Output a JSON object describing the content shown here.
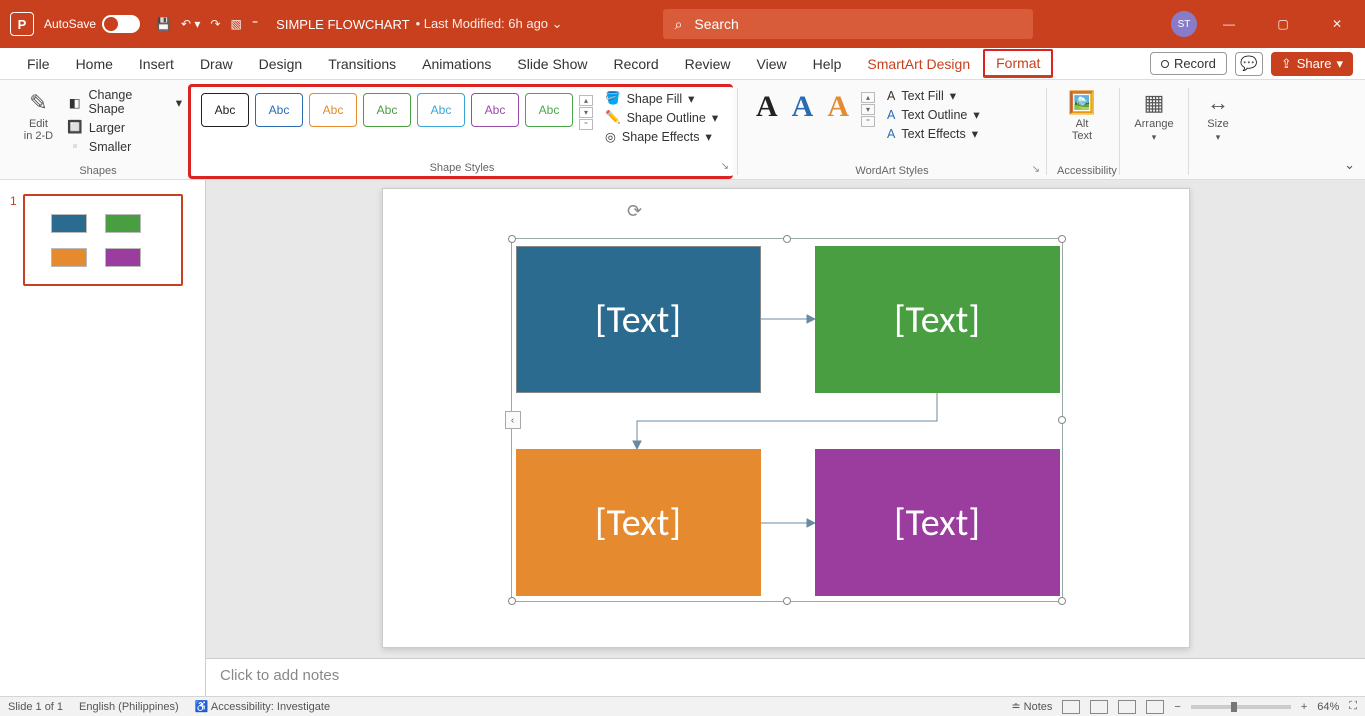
{
  "title": {
    "autosave": "AutoSave",
    "doc": "SIMPLE FLOWCHART",
    "modified": "• Last Modified: 6h ago",
    "search_placeholder": "Search",
    "avatar": "ST"
  },
  "tabs": [
    "File",
    "Home",
    "Insert",
    "Draw",
    "Design",
    "Transitions",
    "Animations",
    "Slide Show",
    "Record",
    "Review",
    "View",
    "Help"
  ],
  "context_tabs": [
    "SmartArt Design",
    "Format"
  ],
  "menu_right": {
    "record": "Record",
    "share": "Share"
  },
  "ribbon": {
    "shapes": {
      "edit2d": "Edit\nin 2-D",
      "change": "Change Shape",
      "larger": "Larger",
      "smaller": "Smaller",
      "label": "Shapes"
    },
    "shape_styles": {
      "swatches": [
        {
          "text": "Abc",
          "border": "#222",
          "fill": "#fff"
        },
        {
          "text": "Abc",
          "border": "#2a6cb1",
          "fill": "#fff"
        },
        {
          "text": "Abc",
          "border": "#e58a2e",
          "fill": "#fff"
        },
        {
          "text": "Abc",
          "border": "#4a9e42",
          "fill": "#fff"
        },
        {
          "text": "Abc",
          "border": "#3aa5d8",
          "fill": "#fff"
        },
        {
          "text": "Abc",
          "border": "#9a4aa8",
          "fill": "#fff"
        },
        {
          "text": "Abc",
          "border": "#4aa84a",
          "fill": "#fff"
        }
      ],
      "fill": "Shape Fill",
      "outline": "Shape Outline",
      "effects": "Shape Effects",
      "label": "Shape Styles"
    },
    "wordart": {
      "text_fill": "Text Fill",
      "text_outline": "Text Outline",
      "text_effects": "Text Effects",
      "label": "WordArt Styles"
    },
    "acc": {
      "alt": "Alt\nText",
      "label": "Accessibility"
    },
    "arrange": "Arrange",
    "size": "Size"
  },
  "slide_num": "1",
  "blocks": {
    "a": "[Text]",
    "b": "[Text]",
    "c": "[Text]",
    "d": "[Text]"
  },
  "notes_placeholder": "Click to add notes",
  "status": {
    "slide": "Slide 1 of 1",
    "lang": "English (Philippines)",
    "acc": "Accessibility: Investigate",
    "notes": "Notes",
    "zoom": "64%"
  }
}
